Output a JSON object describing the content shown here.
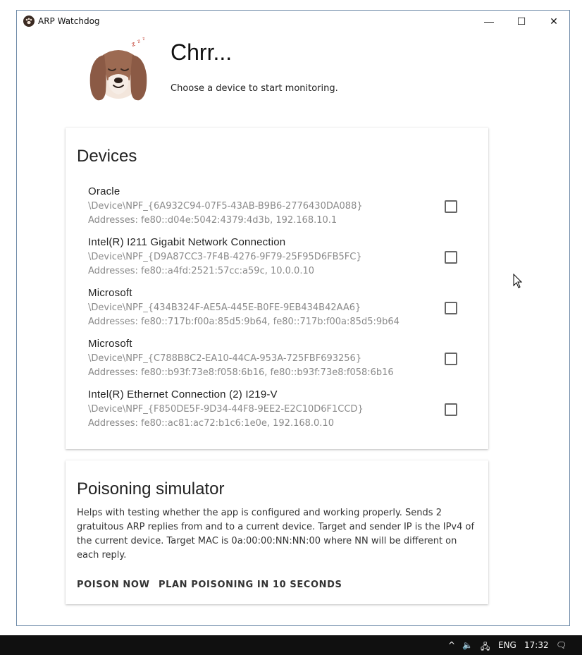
{
  "window": {
    "title": "ARP Watchdog",
    "minimize_glyph": "—",
    "maximize_glyph": "☐",
    "close_glyph": "✕"
  },
  "header": {
    "headline": "Chrr...",
    "subtitle": "Choose a device to start monitoring."
  },
  "devices": {
    "title": "Devices",
    "items": [
      {
        "name": "Oracle",
        "path": "\\Device\\NPF_{6A932C94-07F5-43AB-B9B6-2776430DA088}",
        "addresses": "Addresses: fe80::d04e:5042:4379:4d3b, 192.168.10.1",
        "checked": false
      },
      {
        "name": "Intel(R) I211 Gigabit Network Connection",
        "path": "\\Device\\NPF_{D9A87CC3-7F4B-4276-9F79-25F95D6FB5FC}",
        "addresses": "Addresses: fe80::a4fd:2521:57cc:a59c, 10.0.0.10",
        "checked": false
      },
      {
        "name": "Microsoft",
        "path": "\\Device\\NPF_{434B324F-AE5A-445E-B0FE-9EB434B42AA6}",
        "addresses": "Addresses: fe80::717b:f00a:85d5:9b64, fe80::717b:f00a:85d5:9b64",
        "checked": false
      },
      {
        "name": "Microsoft",
        "path": "\\Device\\NPF_{C788B8C2-EA10-44CA-953A-725FBF693256}",
        "addresses": "Addresses: fe80::b93f:73e8:f058:6b16, fe80::b93f:73e8:f058:6b16",
        "checked": false
      },
      {
        "name": "Intel(R) Ethernet Connection (2) I219-V",
        "path": "\\Device\\NPF_{F850DE5F-9D34-44F8-9EE2-E2C10D6F1CCD}",
        "addresses": "Addresses: fe80::ac81:ac72:b1c6:1e0e, 192.168.0.10",
        "checked": false
      }
    ]
  },
  "simulator": {
    "title": "Poisoning simulator",
    "description": "Helps with testing whether the app is configured and working properly. Sends 2 gratuitous ARP replies from and to a current device. Target and sender IP is the IPv4 of the current device. Target MAC is 0a:00:00:NN:NN:00 where NN will be different on each reply.",
    "poison_now_label": "POISON NOW",
    "plan_label": "PLAN POISONING IN 10 SECONDS"
  },
  "taskbar": {
    "chevron": "^",
    "volume": "🔈",
    "network": "🖧",
    "language": "ENG",
    "time": "17:32",
    "notifications": "🗨"
  },
  "colors": {
    "dog_ear": "#8b5a45",
    "dog_face": "#f3e6dc",
    "window_border": "#6e8aa8",
    "taskbar": "#101010"
  }
}
